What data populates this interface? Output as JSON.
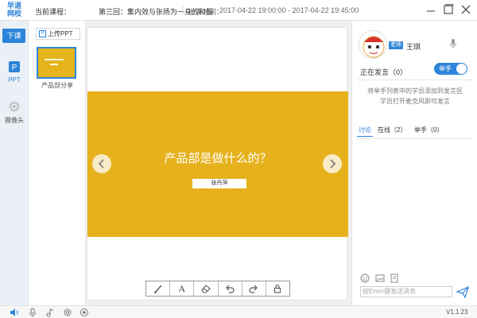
{
  "app": {
    "logo_line1": "早道",
    "logo_line2": "网校"
  },
  "header": {
    "course_label": "当前课程：",
    "course_name": "第三回：集内效与张扬为一身的和服",
    "time_label": "上课时间：",
    "time_value": "2017-04-22 19:00:00 - 2017-04-22 19:45:00"
  },
  "sidebar": {
    "end_class": "下课",
    "items": [
      {
        "label": "PPT",
        "icon": "ppt-icon"
      },
      {
        "label": "摄像头",
        "icon": "camera-icon"
      }
    ]
  },
  "thumbnails": {
    "upload_label": "上传PPT",
    "items": [
      {
        "label": "产品部分享"
      }
    ]
  },
  "slide": {
    "title": "产品部是做什么的？",
    "presenter": "张丹萍"
  },
  "toolbar": {
    "tools": [
      "brush-icon",
      "text-icon",
      "eraser-icon",
      "undo-icon",
      "redo-icon",
      "lock-icon"
    ],
    "text_tool_glyph": "A"
  },
  "panel": {
    "role_tag": "老师",
    "teacher_name": "王琪",
    "speaking_label": "正在发言（0）",
    "handup_toggle": "举手",
    "hint_line1": "将举手列表中的学员添加到发言区",
    "hint_line2": "学员打开麦克风即可发言",
    "tabs": [
      "讨论",
      "在线（2）",
      "举手（0）"
    ],
    "chat_placeholder": "按Enter键发送消息"
  },
  "statusbar": {
    "version": "V1.1.23"
  },
  "colors": {
    "accent": "#2d84d8",
    "slide_bg": "#e6b11c"
  }
}
